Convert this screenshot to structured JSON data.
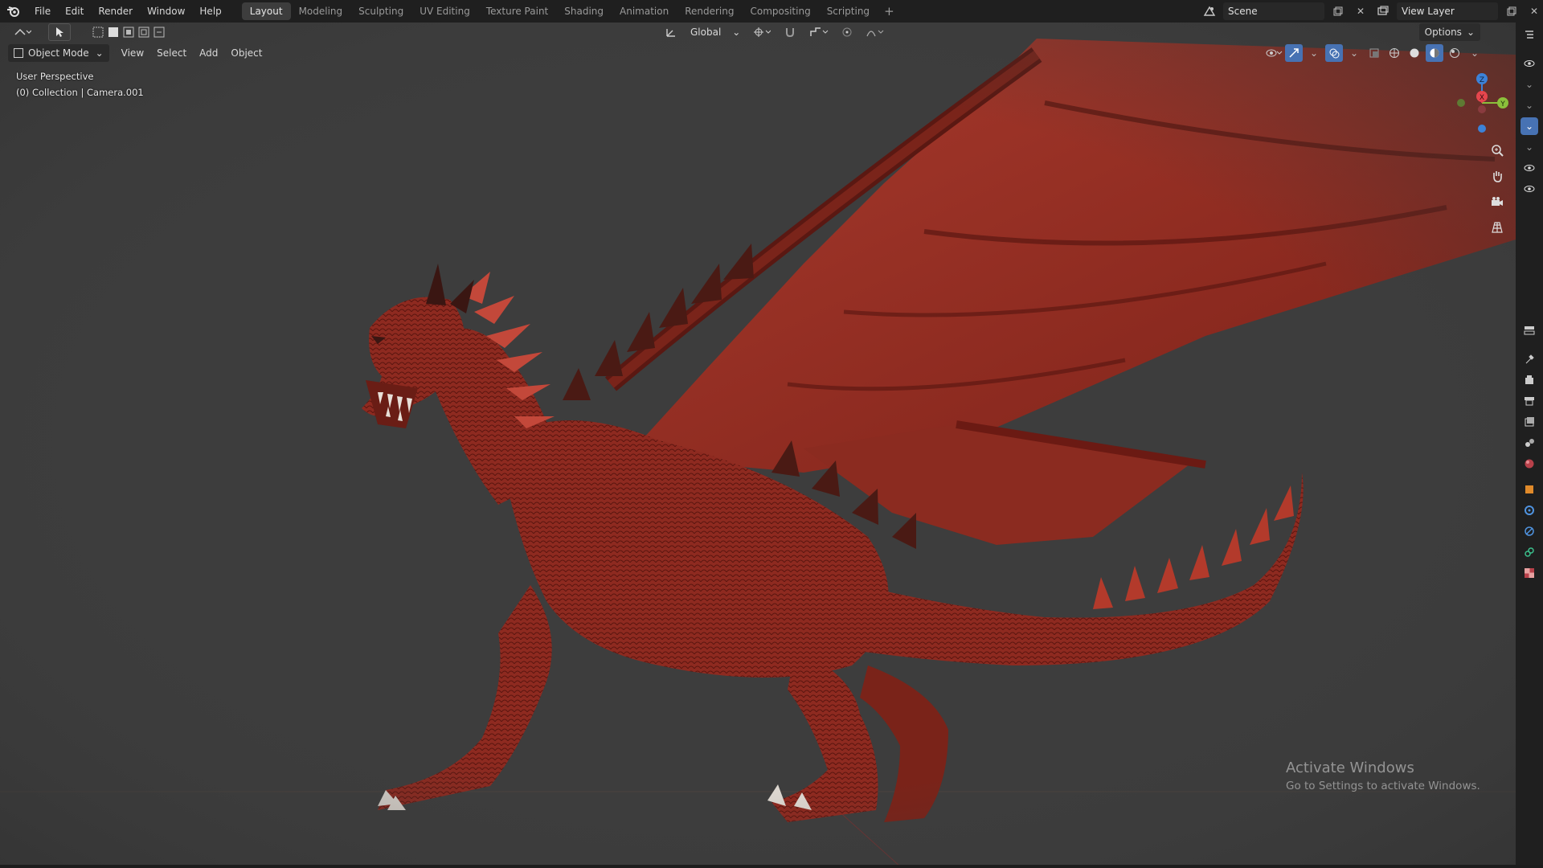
{
  "menu": [
    "File",
    "Edit",
    "Render",
    "Window",
    "Help"
  ],
  "workspace_tabs": [
    {
      "label": "Layout",
      "active": true
    },
    {
      "label": "Modeling",
      "active": false
    },
    {
      "label": "Sculpting",
      "active": false
    },
    {
      "label": "UV Editing",
      "active": false
    },
    {
      "label": "Texture Paint",
      "active": false
    },
    {
      "label": "Shading",
      "active": false
    },
    {
      "label": "Animation",
      "active": false
    },
    {
      "label": "Rendering",
      "active": false
    },
    {
      "label": "Compositing",
      "active": false
    },
    {
      "label": "Scripting",
      "active": false
    }
  ],
  "add_workspace": "+",
  "scene": {
    "name": "Scene",
    "view_layer": "View Layer"
  },
  "toolbar": {
    "transform_orientation": "Global",
    "options_label": "Options"
  },
  "header": {
    "mode": "Object Mode",
    "menus": [
      "View",
      "Select",
      "Add",
      "Object"
    ]
  },
  "viewport": {
    "perspective": "User Perspective",
    "collection": "(0) Collection | Camera.001"
  },
  "gizmo": {
    "z": "Z",
    "x": "X",
    "y": "Y"
  },
  "colors": {
    "viewport_bg": "#3d3d3d",
    "bar_bg": "#1f1f1f",
    "axis_x": "#e5464d",
    "axis_y": "#8bc03b",
    "axis_z": "#3c82d8",
    "dragon_red": "#9b2a20",
    "active_blue": "#4772b3"
  },
  "watermark": {
    "title": "Activate Windows",
    "subtitle": "Go to Settings to activate Windows."
  }
}
